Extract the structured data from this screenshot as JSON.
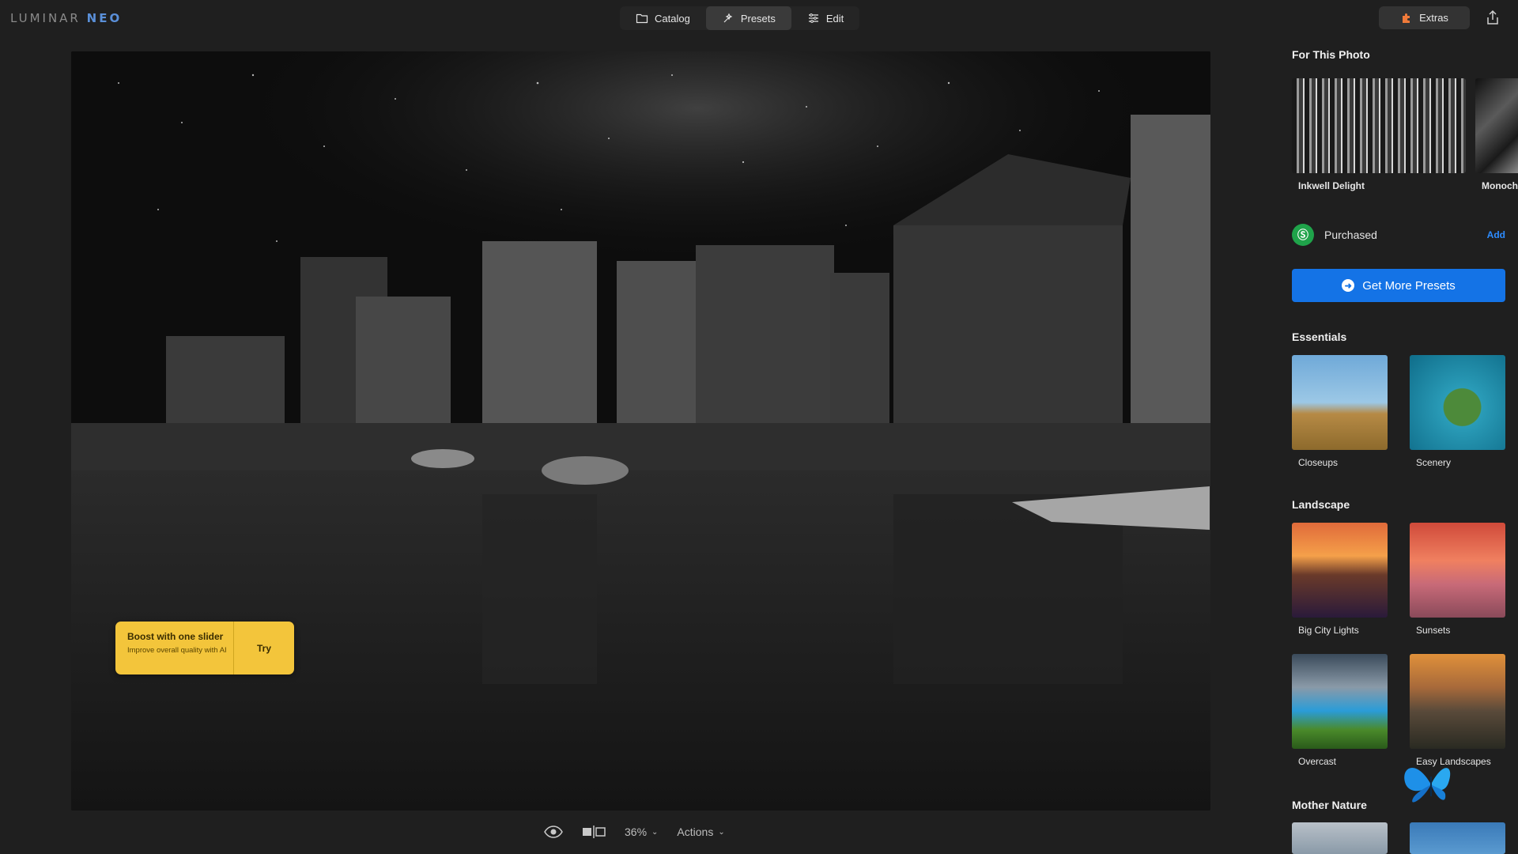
{
  "app": {
    "logo_main": "LUMINAR",
    "logo_accent": "NEO"
  },
  "nav": {
    "tabs": [
      {
        "label": "Catalog",
        "icon": "folder-icon",
        "active": false
      },
      {
        "label": "Presets",
        "icon": "presets-icon",
        "active": true
      },
      {
        "label": "Edit",
        "icon": "sliders-icon",
        "active": false
      }
    ],
    "extras_label": "Extras",
    "share_icon": "share-icon"
  },
  "boost": {
    "title": "Boost with one slider",
    "subtitle": "Improve overall quality with AI",
    "action": "Try"
  },
  "bottom": {
    "zoom": "36%",
    "actions": "Actions"
  },
  "panel": {
    "for_this_photo": {
      "title": "For This Photo",
      "presets": [
        {
          "label": "Inkwell Delight"
        },
        {
          "label": "Monoch"
        }
      ]
    },
    "purchased": {
      "label": "Purchased",
      "add": "Add"
    },
    "get_more": "Get More Presets",
    "essentials": {
      "title": "Essentials",
      "presets": [
        {
          "label": "Closeups"
        },
        {
          "label": "Scenery"
        }
      ]
    },
    "landscape": {
      "title": "Landscape",
      "presets": [
        {
          "label": "Big City Lights"
        },
        {
          "label": "Sunsets"
        },
        {
          "label": "Overcast"
        },
        {
          "label": "Easy Landscapes"
        }
      ]
    },
    "mother_nature": {
      "title": "Mother Nature"
    }
  },
  "colors": {
    "accent_blue": "#1473e6",
    "boost_yellow": "#f3c53b",
    "purchased_green": "#1fa34a"
  }
}
